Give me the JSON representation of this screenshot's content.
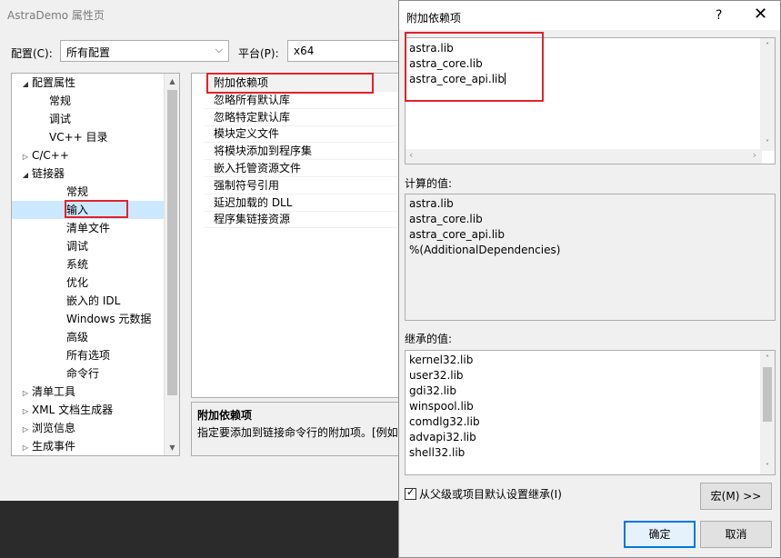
{
  "main_window": {
    "title": "AstraDemo 属性页",
    "config_label": "配置(C):",
    "config_value": "所有配置",
    "platform_label": "平台(P):",
    "platform_value": "x64"
  },
  "tree": [
    {
      "label": "配置属性",
      "toggle": "◢"
    },
    {
      "label": "常规"
    },
    {
      "label": "调试"
    },
    {
      "label": "VC++ 目录"
    },
    {
      "label": "C/C++",
      "toggle": "▷"
    },
    {
      "label": "链接器",
      "toggle": "◢"
    },
    {
      "label": "常规"
    },
    {
      "label": "输入"
    },
    {
      "label": "清单文件"
    },
    {
      "label": "调试"
    },
    {
      "label": "系统"
    },
    {
      "label": "优化"
    },
    {
      "label": "嵌入的 IDL"
    },
    {
      "label": "Windows 元数据"
    },
    {
      "label": "高级"
    },
    {
      "label": "所有选项"
    },
    {
      "label": "命令行"
    },
    {
      "label": "清单工具",
      "toggle": "▷"
    },
    {
      "label": "XML 文档生成器",
      "toggle": "▷"
    },
    {
      "label": "浏览信息",
      "toggle": "▷"
    },
    {
      "label": "生成事件",
      "toggle": "▷"
    }
  ],
  "properties": [
    "附加依赖项",
    "忽略所有默认库",
    "忽略特定默认库",
    "模块定义文件",
    "将模块添加到程序集",
    "嵌入托管资源文件",
    "强制符号引用",
    "延迟加载的 DLL",
    "程序集链接资源"
  ],
  "description": {
    "title": "附加依赖项",
    "text": "指定要添加到链接命令行的附加项。[例如"
  },
  "dialog": {
    "title": "附加依赖项",
    "help": "?",
    "close": "✕",
    "edit_lines": [
      "astra.lib",
      "astra_core.lib",
      "astra_core_api.lib"
    ],
    "evaluated_label": "计算的值:",
    "evaluated_lines": [
      "astra.lib",
      "astra_core.lib",
      "astra_core_api.lib",
      "%(AdditionalDependencies)"
    ],
    "inherited_label": "继承的值:",
    "inherited_lines": [
      "kernel32.lib",
      "user32.lib",
      "gdi32.lib",
      "winspool.lib",
      "comdlg32.lib",
      "advapi32.lib",
      "shell32.lib"
    ],
    "inherit_checkbox": "从父级或项目默认设置继承(I)",
    "macros_button": "宏(M) >>",
    "ok_button": "确定",
    "cancel_button": "取消"
  },
  "icons": {
    "expand": "triangle-down-icon",
    "collapse": "triangle-right-icon",
    "check": "check-icon"
  },
  "colors": {
    "highlight": "#e0232d",
    "selection": "#cce8ff",
    "default_button_border": "#0078d7"
  }
}
